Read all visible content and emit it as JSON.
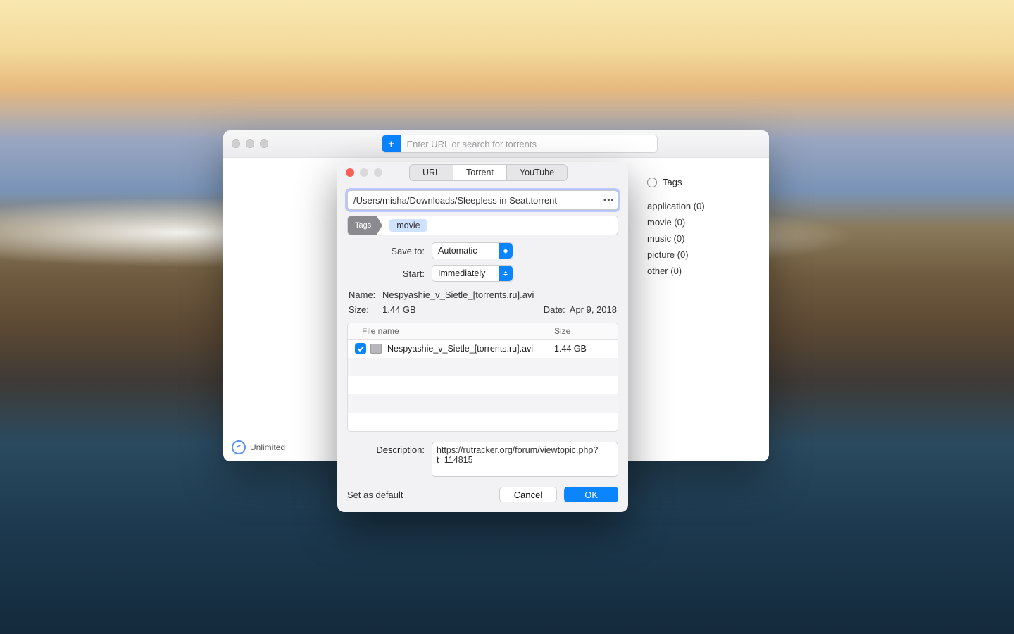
{
  "main": {
    "search_placeholder": "Enter URL or search for torrents",
    "footer_status": "Unlimited"
  },
  "sidebar": {
    "heading": "Tags",
    "items": [
      {
        "label": "application (0)"
      },
      {
        "label": "movie (0)"
      },
      {
        "label": "music (0)"
      },
      {
        "label": "picture (0)"
      },
      {
        "label": "other (0)"
      }
    ]
  },
  "sheet": {
    "tabs": {
      "url": "URL",
      "torrent": "Torrent",
      "youtube": "YouTube"
    },
    "path_value": "/Users/misha/Downloads/Sleepless in Seat.torrent",
    "tags_label": "Tags",
    "tag_pill": "movie",
    "save_to_label": "Save to:",
    "save_to_value": "Automatic",
    "start_label": "Start:",
    "start_value": "Immediately",
    "meta": {
      "name_label": "Name:",
      "name_value": "Nespyashie_v_Sietle_[torrents.ru].avi",
      "size_label": "Size:",
      "size_value": "1.44 GB",
      "date_label": "Date:",
      "date_value": "Apr 9, 2018"
    },
    "table": {
      "col_file": "File name",
      "col_size": "Size",
      "rows": [
        {
          "name": "Nespyashie_v_Sietle_[torrents.ru].avi",
          "size": "1.44 GB",
          "checked": true
        }
      ]
    },
    "desc_label": "Description:",
    "desc_value": "https://rutracker.org/forum/viewtopic.php?t=114815",
    "set_default": "Set as default",
    "cancel": "Cancel",
    "ok": "OK"
  }
}
